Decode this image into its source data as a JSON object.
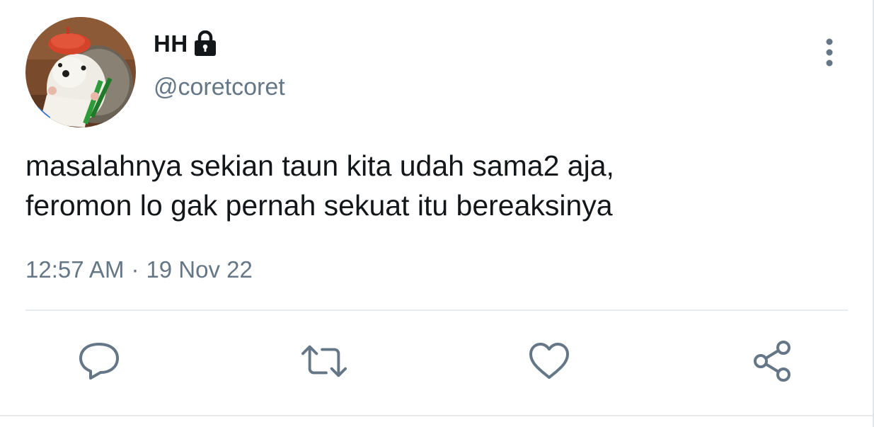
{
  "author": {
    "display_name": "HH",
    "handle": "@coretcoret",
    "protected_icon": "lock-icon",
    "avatar_icon": "hedgehog-avatar"
  },
  "tweet": {
    "text_lines": [
      "masalahnya sekian taun kita udah sama2 aja,",
      "feromon lo gak pernah sekuat itu bereaksinya"
    ],
    "time": "12:57 AM",
    "separator": "·",
    "date": "19 Nov 22"
  },
  "actions": [
    {
      "name": "reply",
      "icon": "reply-bubble-icon"
    },
    {
      "name": "retweet",
      "icon": "retweet-icon"
    },
    {
      "name": "like",
      "icon": "heart-icon"
    },
    {
      "name": "share",
      "icon": "share-icon"
    }
  ],
  "menu": {
    "icon": "more-vertical-icon"
  },
  "colors": {
    "text_primary": "#14171a",
    "text_secondary": "#657786",
    "icon_gray": "#657786",
    "divider": "#e6ecf0"
  }
}
